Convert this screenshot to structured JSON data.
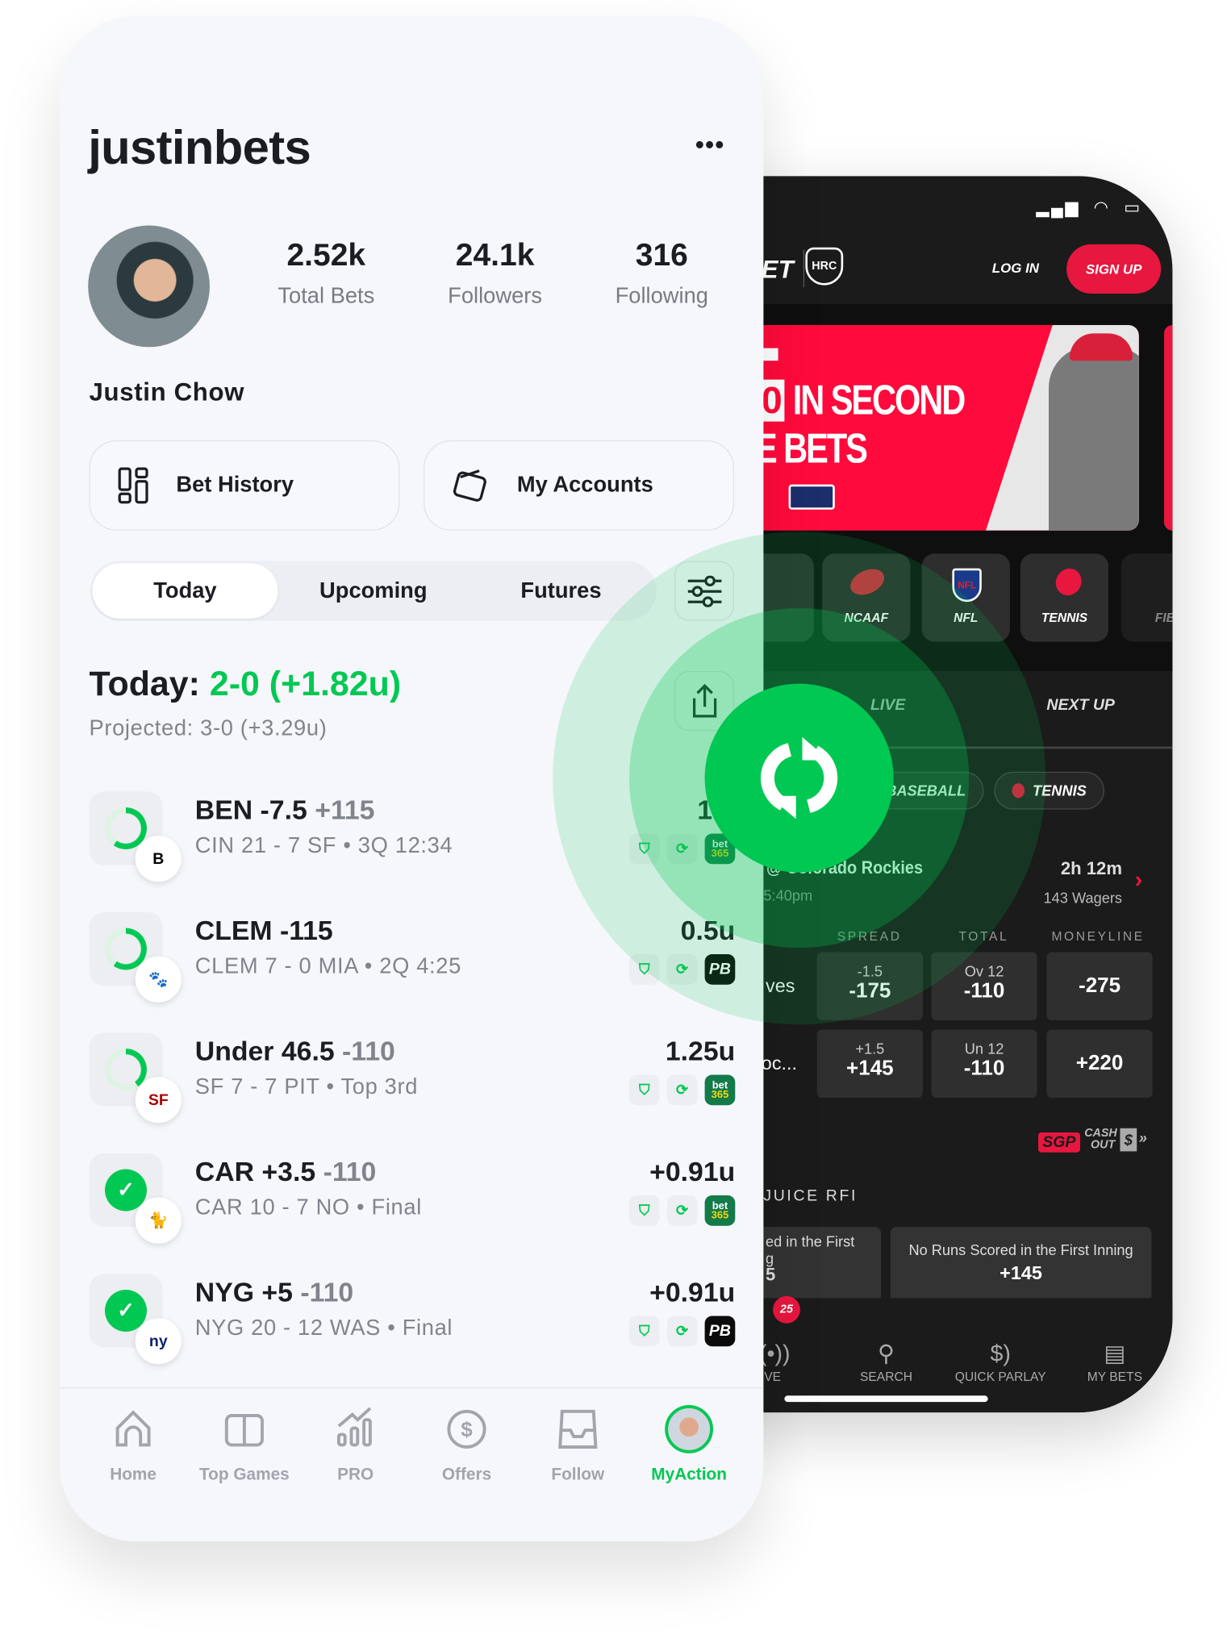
{
  "left_phone": {
    "username": "justinbets",
    "more_icon": "ellipsis-icon",
    "stats": [
      {
        "value": "2.52k",
        "label": "Total Bets"
      },
      {
        "value": "24.1k",
        "label": "Followers"
      },
      {
        "value": "316",
        "label": "Following"
      }
    ],
    "display_name": "Justin Chow",
    "buttons": {
      "bet_history": "Bet History",
      "my_accounts": "My Accounts"
    },
    "tabs": [
      {
        "label": "Today",
        "active": true
      },
      {
        "label": "Upcoming"
      },
      {
        "label": "Futures"
      }
    ],
    "summary": {
      "prefix": "Today:",
      "record": "2-0 (+1.82u)",
      "projected": "Projected: 3-0 (+3.29u)"
    },
    "bets": [
      {
        "pick": "BEN -7.5",
        "odds": "+115",
        "score": "CIN 21 - 7 SF • 3Q 12:34",
        "units": "1.5",
        "book": "bet365",
        "progress": 0.6,
        "team": "Bengals",
        "settled": false
      },
      {
        "pick": "CLEM -115",
        "odds": "",
        "score": "CLEM 7 - 0 MIA • 2Q 4:25",
        "units": "0.5u",
        "book": "PB",
        "progress": 0.6,
        "team": "Clemson",
        "settled": false
      },
      {
        "pick": "Under 46.5",
        "odds": "-110",
        "score": "SF 7 - 7 PIT • Top 3rd",
        "units": "1.25u",
        "book": "bet365",
        "progress": 0.4,
        "team": "49ers/Steelers",
        "settled": false
      },
      {
        "pick": "CAR +3.5",
        "odds": "-110",
        "score": "CAR 10 - 7 NO • Final",
        "units": "+0.91u",
        "book": "bet365",
        "progress": 1,
        "team": "Panthers",
        "settled": true
      },
      {
        "pick": "NYG +5",
        "odds": "-110",
        "score": "NYG 20 - 12 WAS • Final",
        "units": "+0.91u",
        "book": "PB",
        "progress": 1,
        "team": "Giants",
        "settled": true
      }
    ],
    "book_labels": {
      "bet365_top": "bet",
      "bet365_bottom": "365",
      "pb": "PB"
    },
    "team_marks": [
      "B",
      "🐾",
      "SF",
      "🐈",
      "ny"
    ],
    "nav": [
      {
        "label": "Home",
        "icon": "home-icon"
      },
      {
        "label": "Top Games",
        "icon": "scoreboard-icon"
      },
      {
        "label": "PRO",
        "icon": "chart-up-icon"
      },
      {
        "label": "Offers",
        "icon": "dollar-circle-icon"
      },
      {
        "label": "Follow",
        "icon": "inbox-icon"
      },
      {
        "label": "MyAction",
        "icon": "avatar",
        "active": true
      }
    ]
  },
  "right_phone": {
    "brand_fragment": "ET",
    "partner_logo": "HRC",
    "log_in": "LOG IN",
    "sign_up": "SIGN UP",
    "banner": {
      "line1_box": "0",
      "line1": "IN SECOND",
      "line2": "E BETS"
    },
    "sports": [
      "LB",
      "NCAAF",
      "NFL",
      "TENNIS",
      "FIB"
    ],
    "tabs": [
      "LIVE",
      "NEXT UP"
    ],
    "chips": [
      "BASEBALL",
      "TENNIS"
    ],
    "game": {
      "title": "s @ Colorado Rockies",
      "time": "5:40pm",
      "countdown": "2h 12m",
      "wagers": "143 Wagers"
    },
    "columns": [
      "SPREAD",
      "TOTAL",
      "MONEYLINE"
    ],
    "teams": [
      {
        "name": "ves",
        "spread_line": "-1.5",
        "spread_odds": "-175",
        "total_line": "Ov 12",
        "total_odds": "-110",
        "moneyline": "-275"
      },
      {
        "name": "oc...",
        "spread_line": "+1.5",
        "spread_odds": "+145",
        "total_line": "Un 12",
        "total_odds": "-110",
        "moneyline": "+220"
      }
    ],
    "features": {
      "sgp": "SGP",
      "cash_out_1": "CASH",
      "cash_out_2": "OUT"
    },
    "section": "JUICE RFI",
    "props": [
      {
        "l1": "ed in the First",
        "l2": "g",
        "odds": "5"
      },
      {
        "l1": "No Runs Scored in the First Inning",
        "odds": "+145"
      }
    ],
    "nav": [
      {
        "label": "IVE",
        "badge": "25",
        "icon": "live-icon"
      },
      {
        "label": "SEARCH",
        "icon": "search-icon"
      },
      {
        "label": "QUICK PARLAY",
        "icon": "coins-icon"
      },
      {
        "label": "MY BETS",
        "icon": "receipt-icon"
      }
    ]
  },
  "colors": {
    "green": "#00c853",
    "red": "#e8173f",
    "dark": "#1b1b1b",
    "light_bg": "#f6f7fb"
  }
}
